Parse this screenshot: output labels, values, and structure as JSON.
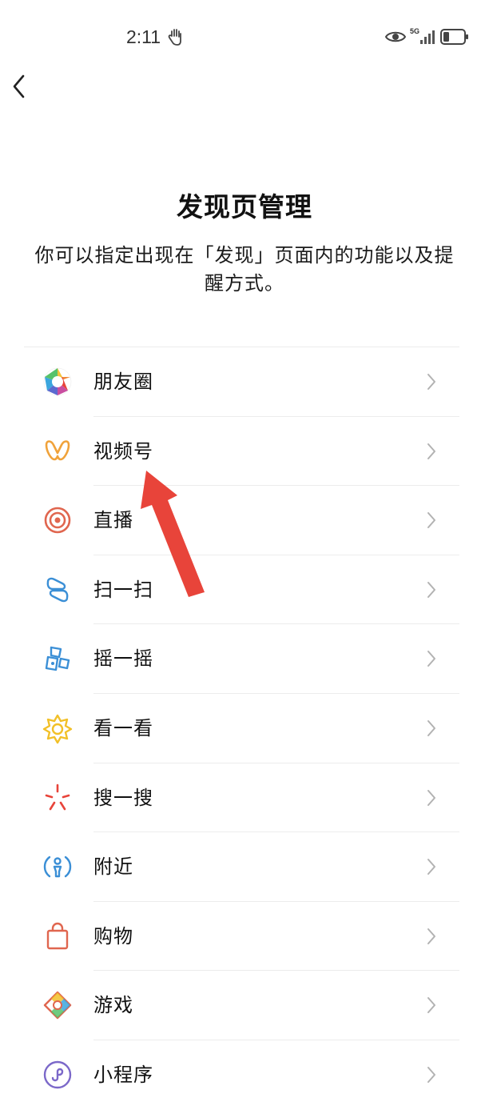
{
  "status_bar": {
    "time": "2:11",
    "network": "5G",
    "icons": [
      "hand-icon",
      "eye-icon",
      "signal-icon",
      "battery-icon"
    ]
  },
  "header": {
    "back_icon": "chevron-left-icon"
  },
  "title": "发现页管理",
  "description": "你可以指定出现在「发现」页面内的功能以及提醒方式。",
  "items": [
    {
      "label": "朋友圈",
      "icon": "moments-icon"
    },
    {
      "label": "视频号",
      "icon": "channels-icon"
    },
    {
      "label": "直播",
      "icon": "live-icon"
    },
    {
      "label": "扫一扫",
      "icon": "scan-icon"
    },
    {
      "label": "摇一摇",
      "icon": "shake-icon"
    },
    {
      "label": "看一看",
      "icon": "top-stories-icon"
    },
    {
      "label": "搜一搜",
      "icon": "search-icon"
    },
    {
      "label": "附近",
      "icon": "nearby-icon"
    },
    {
      "label": "购物",
      "icon": "shopping-bag-icon"
    },
    {
      "label": "游戏",
      "icon": "games-icon"
    },
    {
      "label": "小程序",
      "icon": "mini-programs-icon"
    }
  ],
  "colors": {
    "arrow": "#e8443a",
    "divider": "#ececec",
    "chevron": "#b2b2b2"
  }
}
